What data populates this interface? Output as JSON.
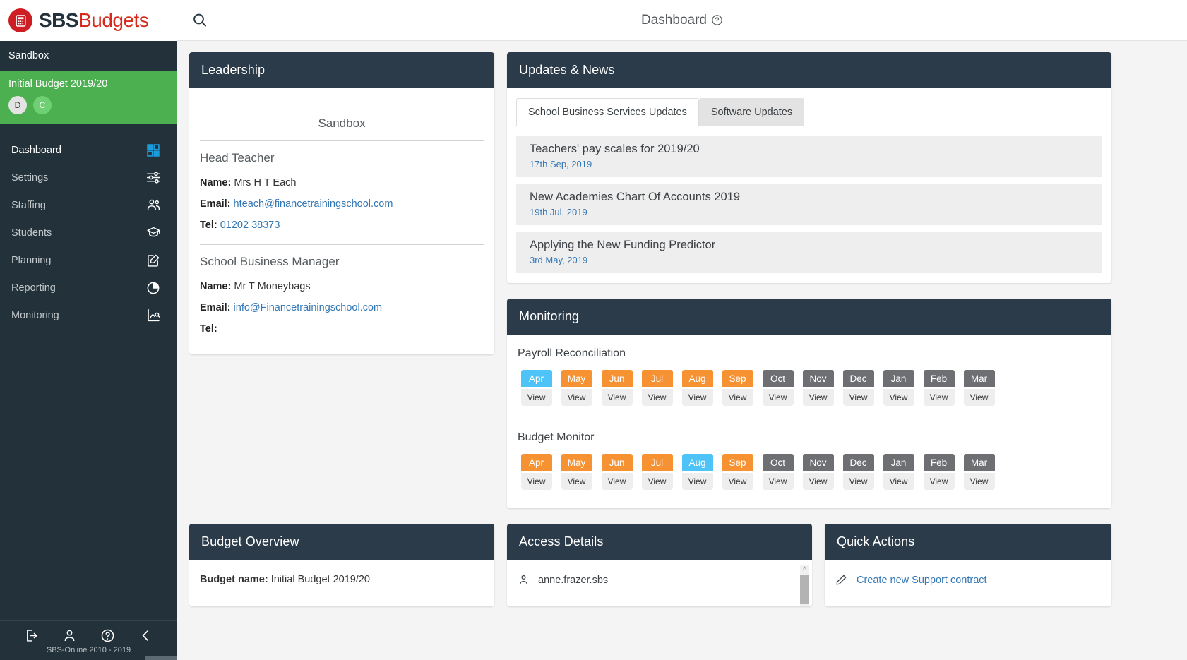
{
  "brand": {
    "sbs": "SBS",
    "budgets": "Budgets",
    "logo_icon": "calculator-icon"
  },
  "sidebar": {
    "org_name": "Sandbox",
    "budget_band": {
      "title": "Initial Budget 2019/20",
      "badges": [
        {
          "label": "D",
          "name": "draft-badge"
        },
        {
          "label": "C",
          "name": "current-badge"
        }
      ]
    },
    "items": [
      {
        "label": "Dashboard",
        "icon": "dashboard-grid-icon",
        "active": true
      },
      {
        "label": "Settings",
        "icon": "sliders-icon",
        "active": false
      },
      {
        "label": "Staffing",
        "icon": "people-icon",
        "active": false
      },
      {
        "label": "Students",
        "icon": "graduation-cap-icon",
        "active": false
      },
      {
        "label": "Planning",
        "icon": "edit-document-icon",
        "active": false
      },
      {
        "label": "Reporting",
        "icon": "pie-chart-icon",
        "active": false
      },
      {
        "label": "Monitoring",
        "icon": "line-graph-icon",
        "active": false
      }
    ],
    "footer": {
      "icons": [
        "logout-icon",
        "user-icon",
        "help-circle-icon",
        "collapse-chevron-left-icon"
      ],
      "copyright": "SBS-Online 2010 - 2019"
    }
  },
  "header": {
    "search_icon": "search-icon",
    "title": "Dashboard",
    "help_icon": "help-circle-icon"
  },
  "leadership": {
    "card_title": "Leadership",
    "school": "Sandbox",
    "roles": [
      {
        "role": "Head Teacher",
        "name_label": "Name:",
        "name_value": "Mrs H T Each",
        "email_label": "Email:",
        "email_value": "hteach@financetrainingschool.com",
        "tel_label": "Tel:",
        "tel_value": "01202 38373"
      },
      {
        "role": "School Business Manager",
        "name_label": "Name:",
        "name_value": "Mr T Moneybags",
        "email_label": "Email:",
        "email_value": "info@Financetrainingschool.com",
        "tel_label": "Tel:",
        "tel_value": ""
      }
    ]
  },
  "updates": {
    "card_title": "Updates & News",
    "tabs": [
      {
        "label": "School Business Services Updates",
        "active": true
      },
      {
        "label": "Software Updates",
        "active": false
      }
    ],
    "items": [
      {
        "title": "Teachers' pay scales for 2019/20",
        "date": "17th Sep, 2019"
      },
      {
        "title": "New Academies Chart Of Accounts 2019",
        "date": "19th Jul, 2019"
      },
      {
        "title": "Applying the New Funding Predictor",
        "date": "3rd May, 2019"
      }
    ]
  },
  "monitoring": {
    "card_title": "Monitoring",
    "view_label": "View",
    "colors": {
      "blue": "#4ec3f7",
      "orange": "#f79233",
      "grey": "#6d6f73"
    },
    "sections": [
      {
        "subtitle": "Payroll Reconciliation",
        "months": [
          {
            "label": "Apr",
            "state": "blue"
          },
          {
            "label": "May",
            "state": "orange"
          },
          {
            "label": "Jun",
            "state": "orange"
          },
          {
            "label": "Jul",
            "state": "orange"
          },
          {
            "label": "Aug",
            "state": "orange"
          },
          {
            "label": "Sep",
            "state": "orange"
          },
          {
            "label": "Oct",
            "state": "grey"
          },
          {
            "label": "Nov",
            "state": "grey"
          },
          {
            "label": "Dec",
            "state": "grey"
          },
          {
            "label": "Jan",
            "state": "grey"
          },
          {
            "label": "Feb",
            "state": "grey"
          },
          {
            "label": "Mar",
            "state": "grey"
          }
        ]
      },
      {
        "subtitle": "Budget Monitor",
        "months": [
          {
            "label": "Apr",
            "state": "orange"
          },
          {
            "label": "May",
            "state": "orange"
          },
          {
            "label": "Jun",
            "state": "orange"
          },
          {
            "label": "Jul",
            "state": "orange"
          },
          {
            "label": "Aug",
            "state": "blue"
          },
          {
            "label": "Sep",
            "state": "orange"
          },
          {
            "label": "Oct",
            "state": "grey"
          },
          {
            "label": "Nov",
            "state": "grey"
          },
          {
            "label": "Dec",
            "state": "grey"
          },
          {
            "label": "Jan",
            "state": "grey"
          },
          {
            "label": "Feb",
            "state": "grey"
          },
          {
            "label": "Mar",
            "state": "grey"
          }
        ]
      }
    ]
  },
  "budget_overview": {
    "card_title": "Budget Overview",
    "name_label": "Budget name:",
    "name_value": "Initial Budget 2019/20"
  },
  "access_details": {
    "card_title": "Access Details",
    "user_icon": "user-icon",
    "username": "anne.frazer.sbs"
  },
  "quick_actions": {
    "card_title": "Quick Actions",
    "items": [
      {
        "icon": "pencil-icon",
        "label": "Create new Support contract"
      }
    ]
  }
}
